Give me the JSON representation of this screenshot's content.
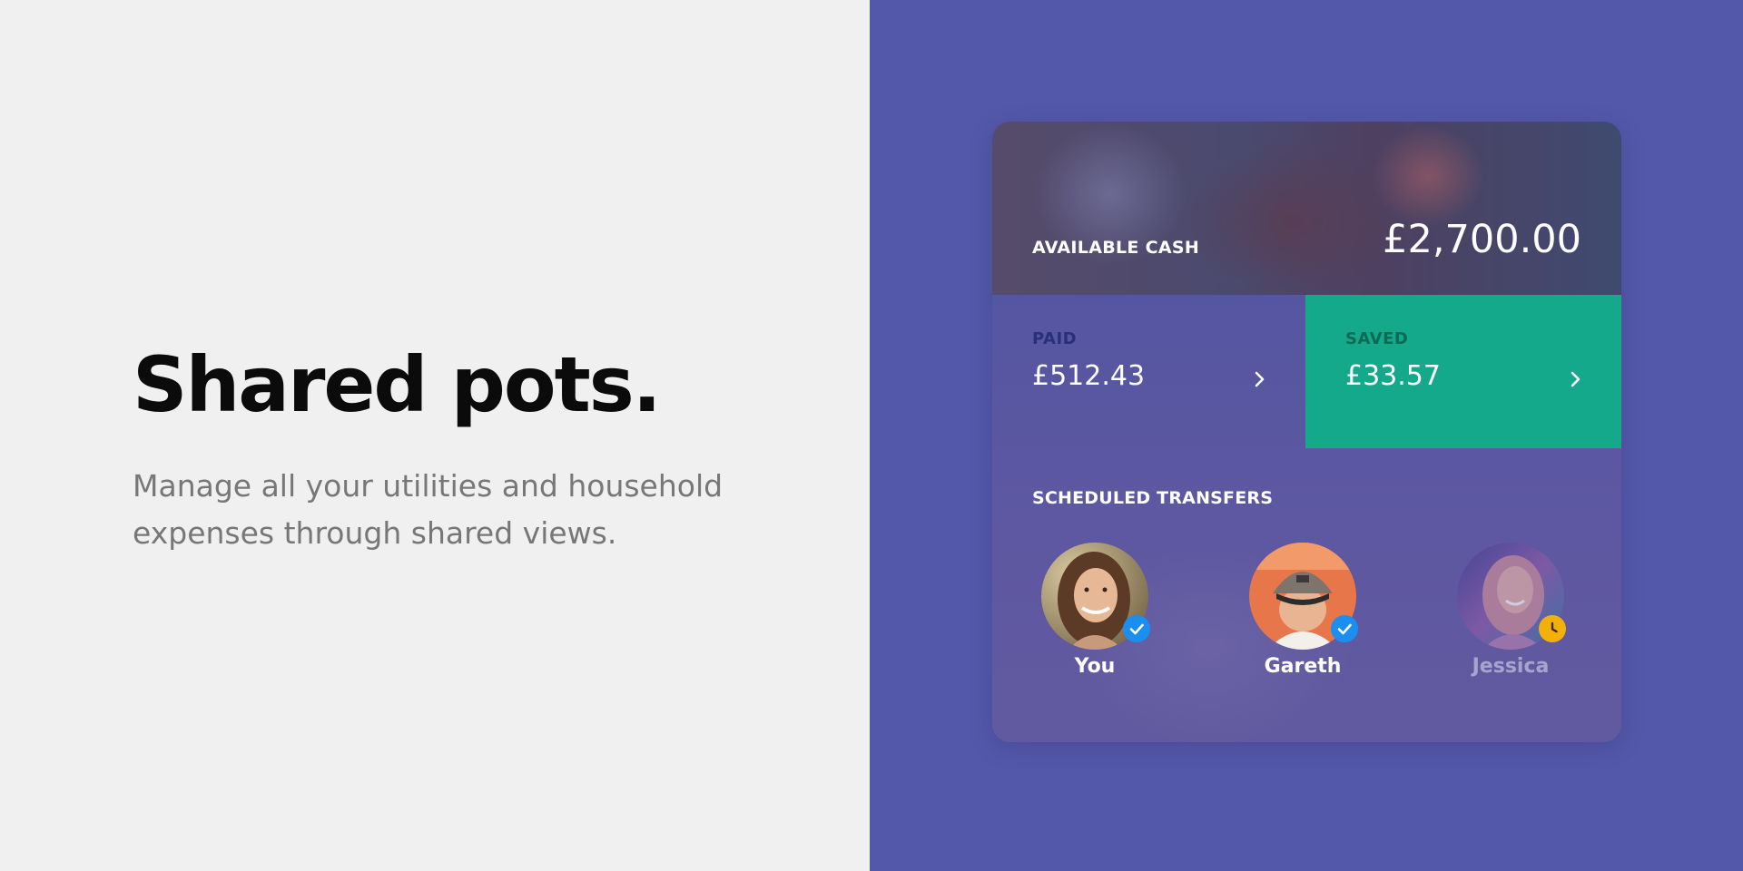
{
  "hero": {
    "title": "Shared pots.",
    "description": "Manage all your utilities and household expenses through shared views."
  },
  "card": {
    "available_cash_label": "AVAILABLE CASH",
    "available_cash_amount": "£2,700.00",
    "paid": {
      "label": "PAID",
      "amount": "£512.43"
    },
    "saved": {
      "label": "SAVED",
      "amount": "£33.57"
    },
    "scheduled_transfers": {
      "title": "SCHEDULED TRANSFERS",
      "people": [
        {
          "name": "You",
          "status": "confirmed",
          "status_icon": "check-icon"
        },
        {
          "name": "Gareth",
          "status": "confirmed",
          "status_icon": "check-icon"
        },
        {
          "name": "Jessica",
          "status": "pending",
          "status_icon": "clock-icon"
        }
      ]
    }
  },
  "colors": {
    "left_background": "#f0f0f0",
    "right_background": "#5458aa",
    "saved_tile": "#14a98b",
    "confirmed_badge": "#1a8ff0",
    "pending_badge": "#f2b10a"
  }
}
